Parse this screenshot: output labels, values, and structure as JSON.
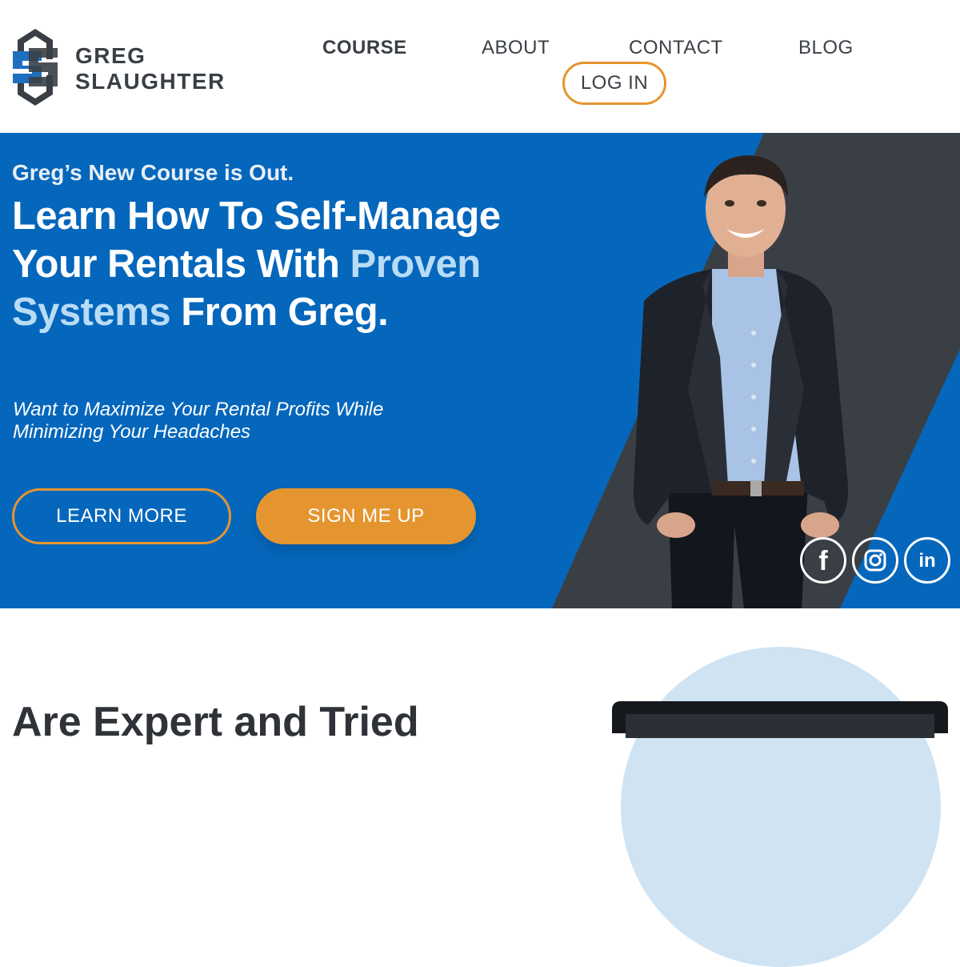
{
  "brand": {
    "line1": "GREG",
    "line2": "SLAUGHTER",
    "logo_colors": {
      "blue": "#1f6fc0",
      "dark": "#3a3f45"
    }
  },
  "nav": {
    "items": [
      {
        "label": "COURSE",
        "active": true
      },
      {
        "label": "ABOUT"
      },
      {
        "label": "CONTACT"
      },
      {
        "label": "BLOG"
      }
    ],
    "login_label": "LOG IN"
  },
  "hero": {
    "kicker": "Greg’s New Course is Out.",
    "title_part1": "Learn How To Self-Manage Your Rentals With ",
    "title_accent": "Proven Systems",
    "title_part2": " From Greg.",
    "subtitle": "Want to Maximize Your Rental Profits While Minimizing Your Headaches",
    "learn_more": "LEARN MORE",
    "sign_up": "SIGN ME UP",
    "colors": {
      "background": "#0567bc",
      "accent": "#b9dcf6",
      "button": "#e5952f",
      "shape": "#3a3f45"
    }
  },
  "social": [
    {
      "icon": "facebook-icon",
      "glyph": "f"
    },
    {
      "icon": "instagram-icon"
    },
    {
      "icon": "linkedin-icon",
      "glyph": "in"
    }
  ],
  "next_section": {
    "heading_partial": "Are Expert and Tried"
  }
}
